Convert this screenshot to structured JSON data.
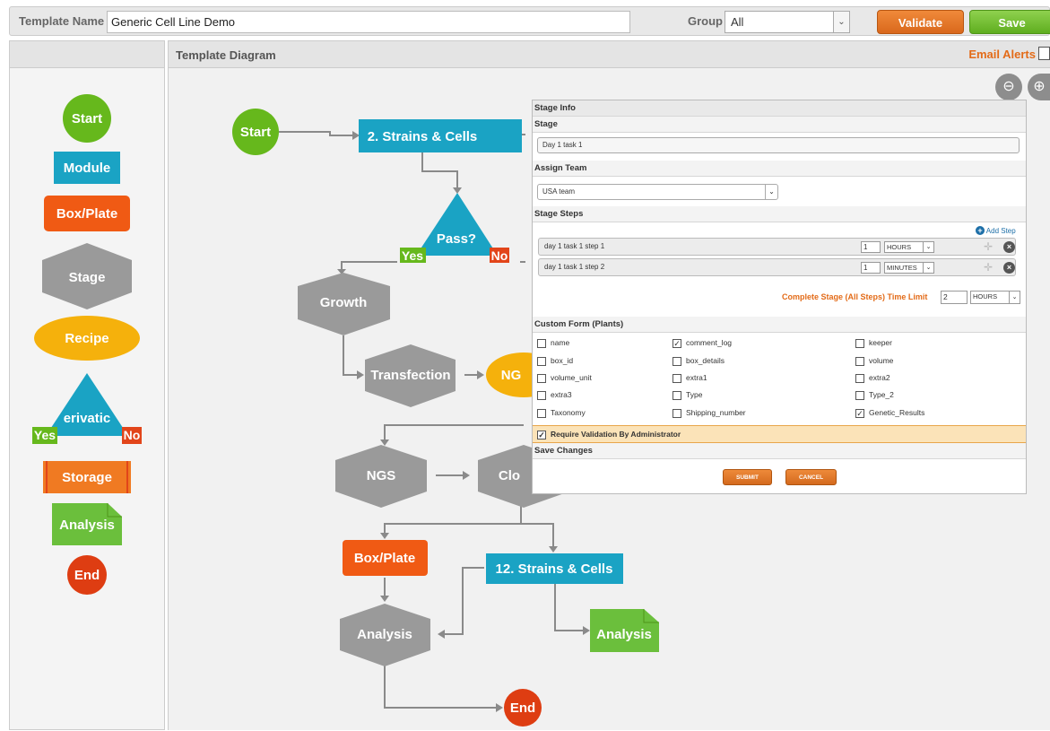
{
  "header": {
    "template_name_label": "Template Name",
    "template_name_value": "Generic Cell Line Demo",
    "group_label": "Group",
    "group_value": "All",
    "validate_label": "Validate",
    "save_label": "Save"
  },
  "palette": {
    "items": [
      "Start",
      "Module",
      "Box/Plate",
      "Stage",
      "Recipe",
      "erivatic",
      "Yes",
      "No",
      "Storage",
      "Analysis",
      "End"
    ]
  },
  "canvas": {
    "title": "Template Diagram",
    "email_alerts_label": "Email Alerts",
    "nodes": {
      "start": "Start",
      "strains1": "2. Strains & Cells",
      "pass": "Pass?",
      "pass_yes": "Yes",
      "pass_no": "No",
      "growth": "Growth",
      "transfection": "Transfection",
      "ngs_partial": "NG",
      "ngs": "NGS",
      "clo_partial": "Clo",
      "boxplate": "Box/Plate",
      "strains12": "12. Strains & Cells",
      "analysis_hex": "Analysis",
      "analysis_doc": "Analysis",
      "end": "End"
    }
  },
  "stage_panel": {
    "title": "Stage Info",
    "stage_label": "Stage",
    "stage_value": "Day 1 task 1",
    "assign_team_label": "Assign Team",
    "team_value": "USA team",
    "stage_steps_label": "Stage Steps",
    "add_step_label": "Add Step",
    "steps": [
      {
        "name": "day 1 task 1 step 1",
        "qty": "1",
        "unit": "HOURS"
      },
      {
        "name": "day 1 task 1 step 2",
        "qty": "1",
        "unit": "MINUTES"
      }
    ],
    "time_limit_label": "Complete Stage (All Steps) Time Limit",
    "time_limit_value": "2",
    "time_limit_unit": "HOURS",
    "custom_form_label": "Custom Form (Plants)",
    "fields": [
      {
        "label": "name",
        "checked": false
      },
      {
        "label": "comment_log",
        "checked": true
      },
      {
        "label": "keeper",
        "checked": false
      },
      {
        "label": "box_id",
        "checked": false
      },
      {
        "label": "box_details",
        "checked": false
      },
      {
        "label": "volume",
        "checked": false
      },
      {
        "label": "volume_unit",
        "checked": false
      },
      {
        "label": "extra1",
        "checked": false
      },
      {
        "label": "extra2",
        "checked": false
      },
      {
        "label": "extra3",
        "checked": false
      },
      {
        "label": "Type",
        "checked": false
      },
      {
        "label": "Type_2",
        "checked": false
      },
      {
        "label": "Taxonomy",
        "checked": false
      },
      {
        "label": "Shipping_number",
        "checked": false
      },
      {
        "label": "Genetic_Results",
        "checked": true
      }
    ],
    "require_validation_label": "Require Validation By Administrator",
    "require_validation_checked": true,
    "save_changes_label": "Save Changes",
    "submit_label": "SUBMIT",
    "cancel_label": "CANCEL"
  },
  "colors": {
    "start_green": "#66b81c",
    "module_teal": "#1aa3c4",
    "boxplate_orange": "#f05a14",
    "stage_gray": "#9a9a9a",
    "recipe_yellow": "#f5b10c",
    "decision_teal": "#1aa3c4",
    "yes_green": "#66b81c",
    "no_red": "#e2451a",
    "storage_orange": "#f07a22",
    "analysis_green": "#6bbf3c",
    "end_red": "#de3d12",
    "accent_orange": "#e36b18"
  }
}
